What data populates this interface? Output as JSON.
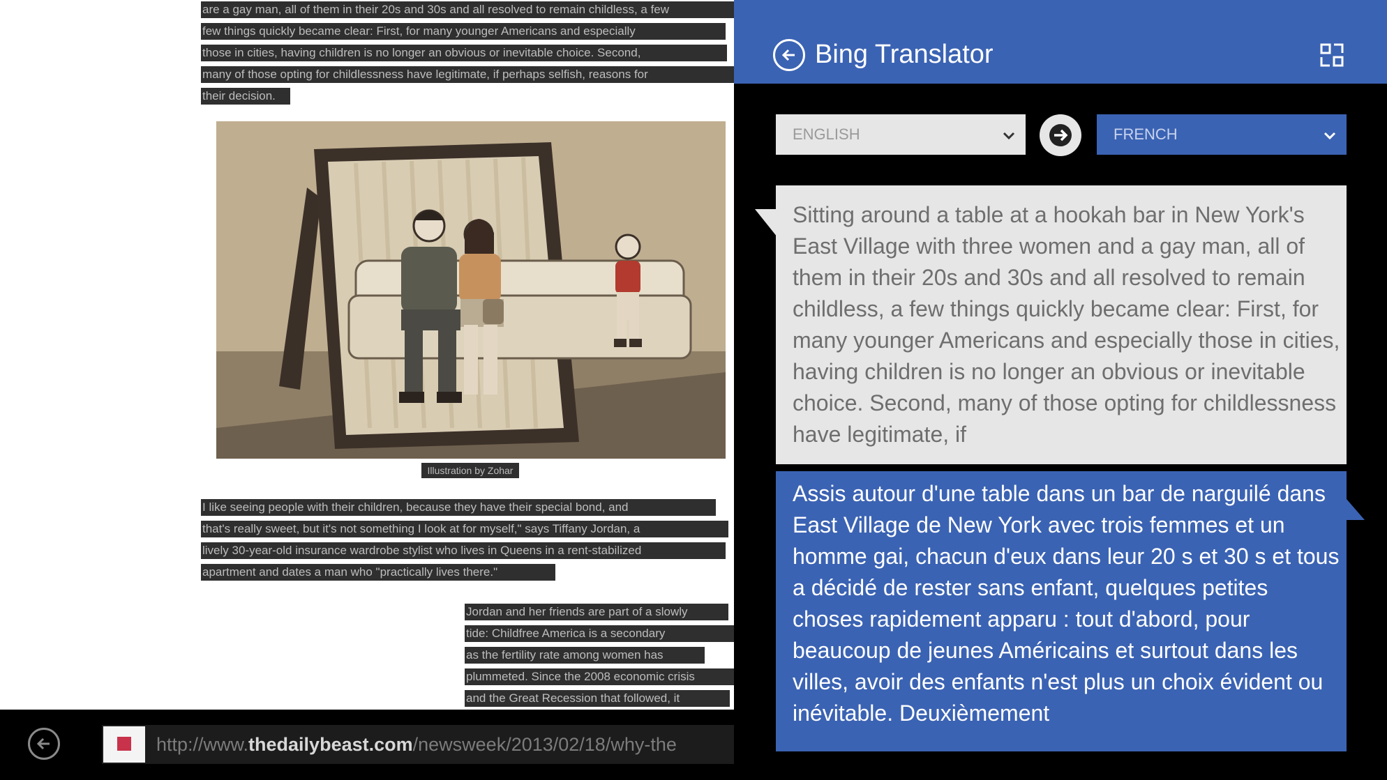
{
  "article": {
    "top_lines": [
      "are a gay man, all of them in their 20s and 30s and all resolved to remain childless, a few",
      "few things quickly became clear: First, for many younger Americans and especially",
      "those in cities, having children is no longer an obvious or inevitable choice. Second,",
      "many of those opting for childlessness have legitimate, if perhaps selfish, reasons for",
      "their decision."
    ],
    "caption": "Illustration by Zohar",
    "mid_lines": [
      "I like seeing people with their children, because they have their special bond, and",
      "that's really sweet, but it's not something I look at for myself,\" says Tiffany Jordan, a",
      "lively 30-year-old insurance wardrobe stylist who lives in Queens in a rent-stabilized",
      "apartment and dates a man who \"practically lives there.\""
    ],
    "col_lines": [
      "Jordan and her friends are part of a slowly",
      "tide: Childfree America is a secondary",
      "as the fertility rate among women has",
      "plummeted. Since the 2008 economic crisis",
      "and the Great Recession that followed, it"
    ]
  },
  "address_bar": {
    "url_prefix": "http://www.",
    "url_domain": "thedailybeast.com",
    "url_path": "/newsweek/2013/02/18/why-the"
  },
  "translator": {
    "app_title": "Bing Translator",
    "from_language": "ENGLISH",
    "to_language": "FRENCH",
    "source_text": "Sitting around a table at a hookah bar in New York's East Village with three women and a gay man, all of them in their 20s and 30s and all resolved to remain childless, a few things quickly became clear: First, for many younger Americans and especially those in cities, having children is no longer an obvious or inevitable choice. Second, many of those opting for childlessness have legitimate, if",
    "translated_text": "Assis autour d'une table dans un bar de narguilé dans East Village de New York avec trois femmes et un homme gai, chacun d'eux dans leur 20 s et 30 s et tous a décidé de rester sans enfant, quelques petites choses rapidement apparu : tout d'abord, pour beaucoup de jeunes Américains et surtout dans les villes, avoir des enfants n'est plus un choix évident ou inévitable. Deuxièmement"
  },
  "colors": {
    "accent_blue": "#3b63b3",
    "panel_light": "#e6e6e6",
    "highlight_dark": "#2f2f2f"
  },
  "icons": [
    "back-arrow-icon",
    "expand-icon",
    "chevron-down-icon",
    "arrow-right-icon",
    "favicon-icon"
  ]
}
